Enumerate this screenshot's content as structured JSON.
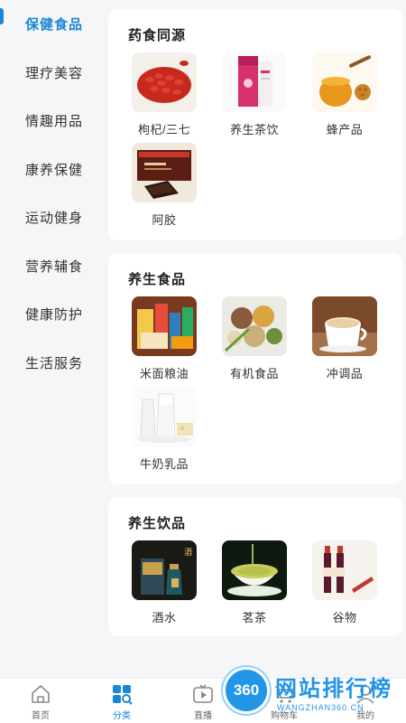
{
  "sidebar": {
    "items": [
      {
        "label": "保健食品",
        "active": true
      },
      {
        "label": "理疗美容",
        "active": false
      },
      {
        "label": "情趣用品",
        "active": false
      },
      {
        "label": "康养保健",
        "active": false
      },
      {
        "label": "运动健身",
        "active": false
      },
      {
        "label": "营养辅食",
        "active": false
      },
      {
        "label": "健康防护",
        "active": false
      },
      {
        "label": "生活服务",
        "active": false
      }
    ]
  },
  "sections": [
    {
      "title": "药食同源",
      "products": [
        {
          "label": "枸杞/三七",
          "icon": "goji-berry-image"
        },
        {
          "label": "养生茶饮",
          "icon": "tea-box-image"
        },
        {
          "label": "蜂产品",
          "icon": "honey-image"
        },
        {
          "label": "阿胶",
          "icon": "ejiao-image"
        }
      ]
    },
    {
      "title": "养生食品",
      "products": [
        {
          "label": "米面粮油",
          "icon": "grain-oil-image"
        },
        {
          "label": "有机食品",
          "icon": "organic-food-image"
        },
        {
          "label": "冲调品",
          "icon": "drink-powder-image"
        },
        {
          "label": "牛奶乳品",
          "icon": "milk-dairy-image"
        }
      ]
    },
    {
      "title": "养生饮品",
      "products": [
        {
          "label": "酒水",
          "icon": "liquor-image"
        },
        {
          "label": "茗茶",
          "icon": "tea-cup-image"
        },
        {
          "label": "谷物",
          "icon": "grain-drink-image"
        }
      ]
    }
  ],
  "tabbar": {
    "items": [
      {
        "label": "首页",
        "icon": "home-icon"
      },
      {
        "label": "分类",
        "icon": "category-icon",
        "active": true
      },
      {
        "label": "直播",
        "icon": "live-icon"
      },
      {
        "label": "购物车",
        "icon": "cart-icon"
      },
      {
        "label": "我的",
        "icon": "profile-icon"
      }
    ]
  },
  "watermark": {
    "badge": "360",
    "text": "网站排行榜",
    "sub": "WANGZHAN360.CN"
  },
  "colors": {
    "accent": "#1a86d8",
    "background": "#f5f6f8",
    "card": "#ffffff"
  }
}
